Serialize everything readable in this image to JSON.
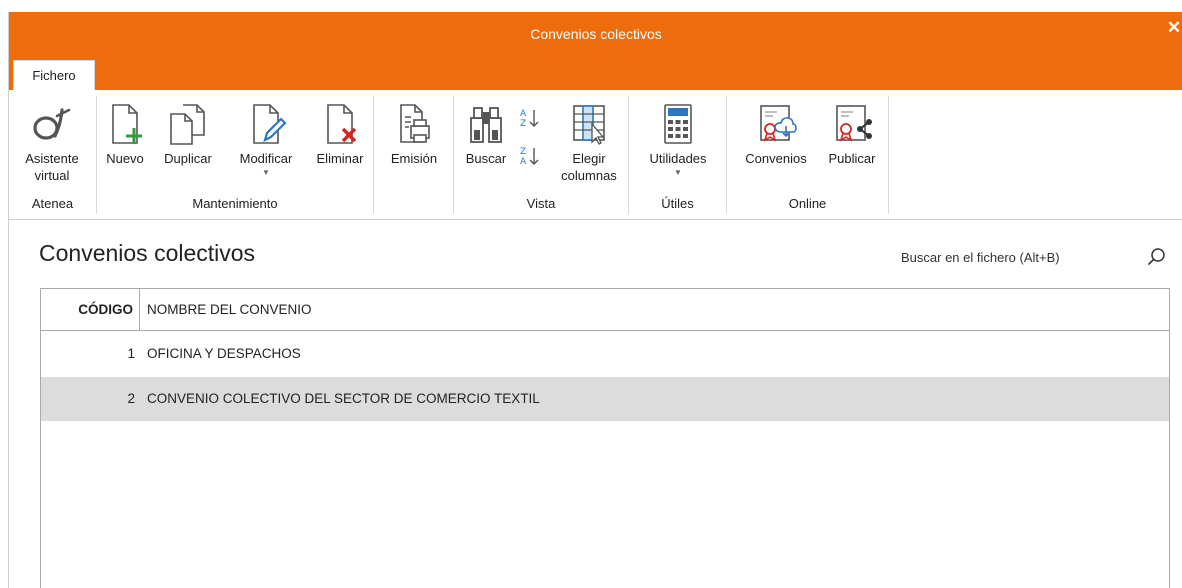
{
  "window": {
    "title": "Convenios colectivos",
    "close_glyph": "✕"
  },
  "tabs": {
    "file": "Fichero"
  },
  "ribbon": {
    "groups": [
      {
        "label": "Atenea",
        "buttons": [
          {
            "label": "Asistente\nvirtual",
            "icon": "atenea-icon"
          }
        ]
      },
      {
        "label": "Mantenimiento",
        "buttons": [
          {
            "label": "Nuevo",
            "icon": "new-document-icon"
          },
          {
            "label": "Duplicar",
            "icon": "duplicate-icon"
          },
          {
            "label": "Modificar",
            "icon": "edit-document-icon",
            "has_dropdown": true
          },
          {
            "label": "Eliminar",
            "icon": "delete-document-icon"
          }
        ]
      },
      {
        "label": "",
        "buttons": [
          {
            "label": "Emisión",
            "icon": "print-icon"
          }
        ]
      },
      {
        "label": "Vista",
        "buttons": [
          {
            "label": "Buscar",
            "icon": "binoculars-icon"
          },
          {
            "label": "",
            "icon": "sort-icon"
          },
          {
            "label": "Elegir\ncolumnas",
            "icon": "columns-icon"
          }
        ]
      },
      {
        "label": "Útiles",
        "buttons": [
          {
            "label": "Utilidades",
            "icon": "calculator-icon",
            "has_dropdown": true
          }
        ]
      },
      {
        "label": "Online",
        "buttons": [
          {
            "label": "Convenios",
            "icon": "download-convenio-icon"
          },
          {
            "label": "Publicar",
            "icon": "share-icon"
          }
        ]
      }
    ]
  },
  "page": {
    "title": "Convenios colectivos"
  },
  "search": {
    "placeholder": "Buscar en el fichero (Alt+B)"
  },
  "table": {
    "columns": [
      "CÓDIGO",
      "NOMBRE DEL CONVENIO"
    ],
    "rows": [
      {
        "code": "1",
        "name": "OFICINA Y DESPACHOS",
        "selected": false
      },
      {
        "code": "2",
        "name": "CONVENIO COLECTIVO DEL SECTOR DE COMERCIO TEXTIL",
        "selected": true
      }
    ]
  },
  "colors": {
    "accent": "#ee6c0c",
    "selected_row": "#dcdcdc",
    "icon_green": "#2e9e3a",
    "icon_red": "#d9231f",
    "icon_blue": "#2f76c2"
  }
}
